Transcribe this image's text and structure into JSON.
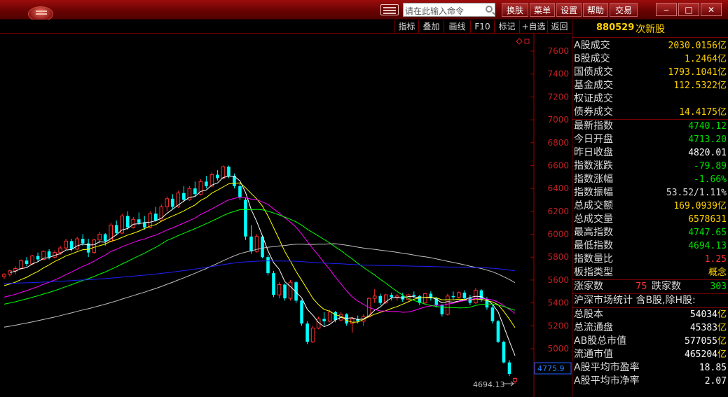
{
  "titlebar": {
    "search_placeholder": "请在此输入命令",
    "menus": [
      "换肤",
      "菜单",
      "设置",
      "帮助",
      "交易"
    ],
    "window_buttons": [
      "‒",
      "□",
      "✕"
    ]
  },
  "toolbar": {
    "items": [
      "指标",
      "叠加",
      "画线",
      "F10",
      "标记",
      "+自选",
      "返回"
    ]
  },
  "panel": {
    "code": "880529",
    "name": "次新股",
    "rows": [
      {
        "label": "A股成交",
        "value": "2030.0156",
        "unit": "亿",
        "color": "#ffd200"
      },
      {
        "label": "B股成交",
        "value": "1.2464",
        "unit": "亿",
        "color": "#ffd200"
      },
      {
        "label": "国债成交",
        "value": "1793.1041",
        "unit": "亿",
        "color": "#ffd200"
      },
      {
        "label": "基金成交",
        "value": "112.5322",
        "unit": "亿",
        "color": "#ffd200"
      },
      {
        "label": "权证成交",
        "value": "",
        "unit": "",
        "color": "#ffd200"
      },
      {
        "label": "债券成交",
        "value": "14.4175",
        "unit": "亿",
        "color": "#ffd200"
      },
      {
        "label": "最新指数",
        "value": "4740.12",
        "unit": "",
        "color": "#00e000"
      },
      {
        "label": "今日开盘",
        "value": "4713.20",
        "unit": "",
        "color": "#00e000"
      },
      {
        "label": "昨日收盘",
        "value": "4820.01",
        "unit": "",
        "color": "#ffffff"
      },
      {
        "label": "指数涨跌",
        "value": "-79.89",
        "unit": "",
        "color": "#00e000"
      },
      {
        "label": "指数涨幅",
        "value": "-1.66%",
        "unit": "",
        "color": "#00e000"
      },
      {
        "label": "指数振幅",
        "value": "53.52/1.11%",
        "unit": "",
        "color": "#dcdcdc"
      },
      {
        "label": "总成交额",
        "value": "169.0939",
        "unit": "亿",
        "color": "#ffd200"
      },
      {
        "label": "总成交量",
        "value": "6578631",
        "unit": "",
        "color": "#ffd200"
      },
      {
        "label": "最高指数",
        "value": "4747.65",
        "unit": "",
        "color": "#00e000"
      },
      {
        "label": "最低指数",
        "value": "4694.13",
        "unit": "",
        "color": "#00e000"
      },
      {
        "label": "指数量比",
        "value": "1.25",
        "unit": "",
        "color": "#ff3030"
      },
      {
        "label": "板指类型",
        "value": "概念",
        "unit": "",
        "color": "#ffd200"
      }
    ],
    "updown": {
      "up_label": "涨家数",
      "up_value": "75",
      "down_label": "跌家数",
      "down_value": "303"
    },
    "stats_title": "沪深市场统计 含B股,除H股:",
    "stats": [
      {
        "label": "总股本",
        "value": "54034",
        "unit": "亿"
      },
      {
        "label": "总流通盘",
        "value": "45383",
        "unit": "亿"
      },
      {
        "label": "AB股总市值",
        "value": "577055",
        "unit": "亿"
      },
      {
        "label": "流通市值",
        "value": "465204",
        "unit": "亿"
      },
      {
        "label": "A股平均市盈率",
        "value": "18.85",
        "unit": ""
      },
      {
        "label": "A股平均市净率",
        "value": "2.07",
        "unit": ""
      }
    ]
  },
  "chart_data": {
    "type": "candlestick",
    "ylim": [
      4650,
      7700
    ],
    "yticks": [
      5000,
      5200,
      5400,
      5600,
      5800,
      6000,
      6200,
      6400,
      6600,
      6800,
      7000,
      7200,
      7400,
      7600
    ],
    "current_price_label": "4775.9",
    "low_annotation": "4694.13",
    "colors": {
      "up": "#ff3030",
      "down": "#00ffff",
      "ma5": "#ffffff",
      "ma10": "#ffff00",
      "ma20": "#ff00ff",
      "ma30": "#00ff00",
      "ma60": "#c0c0c0",
      "ma120": "#2020ff"
    },
    "candles": [
      [
        5630,
        5660,
        5610,
        5650
      ],
      [
        5650,
        5690,
        5630,
        5680
      ],
      [
        5680,
        5720,
        5650,
        5700
      ],
      [
        5700,
        5780,
        5690,
        5770
      ],
      [
        5770,
        5800,
        5720,
        5740
      ],
      [
        5740,
        5820,
        5730,
        5810
      ],
      [
        5810,
        5840,
        5760,
        5780
      ],
      [
        5780,
        5860,
        5770,
        5850
      ],
      [
        5850,
        5870,
        5780,
        5800
      ],
      [
        5800,
        5860,
        5790,
        5840
      ],
      [
        5840,
        5900,
        5820,
        5880
      ],
      [
        5880,
        5960,
        5860,
        5940
      ],
      [
        5940,
        5960,
        5850,
        5870
      ],
      [
        5870,
        5980,
        5860,
        5960
      ],
      [
        5960,
        6000,
        5900,
        5920
      ],
      [
        5920,
        5960,
        5800,
        5840
      ],
      [
        5840,
        5960,
        5830,
        5950
      ],
      [
        5950,
        6020,
        5920,
        6000
      ],
      [
        6000,
        6010,
        5900,
        5940
      ],
      [
        5940,
        6100,
        5930,
        6080
      ],
      [
        6080,
        6120,
        5990,
        6010
      ],
      [
        6010,
        6180,
        6000,
        6160
      ],
      [
        6160,
        6200,
        6040,
        6060
      ],
      [
        6060,
        6150,
        6050,
        6130
      ],
      [
        6130,
        6190,
        6080,
        6100
      ],
      [
        6100,
        6160,
        6040,
        6060
      ],
      [
        6060,
        6200,
        6050,
        6180
      ],
      [
        6180,
        6240,
        6110,
        6120
      ],
      [
        6120,
        6260,
        6110,
        6240
      ],
      [
        6240,
        6330,
        6200,
        6310
      ],
      [
        6310,
        6350,
        6220,
        6240
      ],
      [
        6240,
        6380,
        6230,
        6360
      ],
      [
        6360,
        6420,
        6280,
        6300
      ],
      [
        6300,
        6420,
        6290,
        6400
      ],
      [
        6400,
        6460,
        6330,
        6350
      ],
      [
        6350,
        6480,
        6340,
        6460
      ],
      [
        6460,
        6510,
        6400,
        6420
      ],
      [
        6420,
        6540,
        6410,
        6520
      ],
      [
        6520,
        6560,
        6470,
        6490
      ],
      [
        6490,
        6600,
        6480,
        6590
      ],
      [
        6590,
        6600,
        6490,
        6510
      ],
      [
        6510,
        6530,
        6400,
        6420
      ],
      [
        6420,
        6440,
        6300,
        6320
      ],
      [
        6300,
        6320,
        5950,
        5980
      ],
      [
        5980,
        6080,
        5830,
        5850
      ],
      [
        5850,
        6000,
        5840,
        5980
      ],
      [
        5980,
        5990,
        5790,
        5800
      ],
      [
        5800,
        5820,
        5640,
        5660
      ],
      [
        5660,
        5680,
        5450,
        5470
      ],
      [
        5470,
        5580,
        5440,
        5560
      ],
      [
        5560,
        5570,
        5420,
        5440
      ],
      [
        5440,
        5600,
        5420,
        5580
      ],
      [
        5580,
        5590,
        5400,
        5420
      ],
      [
        5420,
        5430,
        5200,
        5220
      ],
      [
        5220,
        5240,
        5040,
        5060
      ],
      [
        5060,
        5200,
        5050,
        5180
      ],
      [
        5180,
        5280,
        5170,
        5260
      ],
      [
        5260,
        5320,
        5200,
        5240
      ],
      [
        5240,
        5340,
        5230,
        5320
      ],
      [
        5320,
        5330,
        5230,
        5250
      ],
      [
        5250,
        5320,
        5240,
        5300
      ],
      [
        5300,
        5310,
        5200,
        5220
      ],
      [
        5220,
        5280,
        5140,
        5260
      ],
      [
        5260,
        5290,
        5220,
        5240
      ],
      [
        5240,
        5300,
        5200,
        5280
      ],
      [
        5280,
        5450,
        5270,
        5440
      ],
      [
        5440,
        5520,
        5400,
        5460
      ],
      [
        5460,
        5480,
        5380,
        5400
      ],
      [
        5400,
        5480,
        5390,
        5470
      ],
      [
        5470,
        5490,
        5420,
        5450
      ],
      [
        5450,
        5480,
        5420,
        5460
      ],
      [
        5460,
        5490,
        5410,
        5430
      ],
      [
        5430,
        5480,
        5420,
        5470
      ],
      [
        5470,
        5500,
        5440,
        5460
      ],
      [
        5460,
        5470,
        5380,
        5400
      ],
      [
        5400,
        5490,
        5390,
        5480
      ],
      [
        5480,
        5500,
        5420,
        5440
      ],
      [
        5440,
        5450,
        5360,
        5380
      ],
      [
        5380,
        5390,
        5280,
        5300
      ],
      [
        5300,
        5480,
        5290,
        5460
      ],
      [
        5460,
        5500,
        5430,
        5450
      ],
      [
        5450,
        5500,
        5440,
        5490
      ],
      [
        5490,
        5510,
        5420,
        5440
      ],
      [
        5440,
        5470,
        5380,
        5400
      ],
      [
        5400,
        5530,
        5390,
        5510
      ],
      [
        5510,
        5520,
        5410,
        5430
      ],
      [
        5430,
        5450,
        5340,
        5360
      ],
      [
        5360,
        5380,
        5220,
        5240
      ],
      [
        5240,
        5250,
        5050,
        5060
      ],
      [
        5060,
        5070,
        4870,
        4880
      ],
      [
        4880,
        4900,
        4760,
        4780
      ],
      [
        4713,
        4748,
        4694,
        4740
      ]
    ],
    "ma_start": {
      "ma60": 30,
      "ma120": 0
    }
  }
}
